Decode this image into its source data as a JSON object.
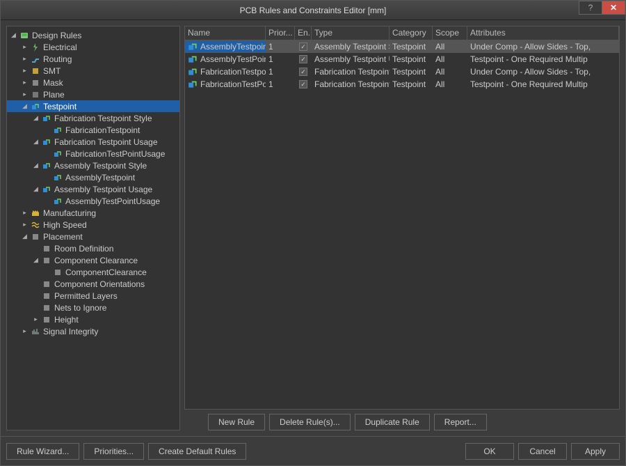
{
  "title": "PCB Rules and Constraints Editor [mm]",
  "tree": [
    {
      "label": "Design Rules",
      "indent": 0,
      "expander": "open",
      "icon": "rules"
    },
    {
      "label": "Electrical",
      "indent": 1,
      "expander": "closed",
      "icon": "electrical"
    },
    {
      "label": "Routing",
      "indent": 1,
      "expander": "closed",
      "icon": "routing"
    },
    {
      "label": "SMT",
      "indent": 1,
      "expander": "closed",
      "icon": "smt"
    },
    {
      "label": "Mask",
      "indent": 1,
      "expander": "closed",
      "icon": "mask"
    },
    {
      "label": "Plane",
      "indent": 1,
      "expander": "closed",
      "icon": "plane"
    },
    {
      "label": "Testpoint",
      "indent": 1,
      "expander": "open",
      "icon": "testpoint",
      "selected": true
    },
    {
      "label": "Fabrication Testpoint Style",
      "indent": 2,
      "expander": "open",
      "icon": "testpoint"
    },
    {
      "label": "FabricationTestpoint",
      "indent": 3,
      "expander": "none",
      "icon": "testpoint"
    },
    {
      "label": "Fabrication Testpoint Usage",
      "indent": 2,
      "expander": "open",
      "icon": "testpoint"
    },
    {
      "label": "FabricationTestPointUsage",
      "indent": 3,
      "expander": "none",
      "icon": "testpoint"
    },
    {
      "label": "Assembly Testpoint Style",
      "indent": 2,
      "expander": "open",
      "icon": "testpoint"
    },
    {
      "label": "AssemblyTestpoint",
      "indent": 3,
      "expander": "none",
      "icon": "testpoint"
    },
    {
      "label": "Assembly Testpoint Usage",
      "indent": 2,
      "expander": "open",
      "icon": "testpoint"
    },
    {
      "label": "AssemblyTestPointUsage",
      "indent": 3,
      "expander": "none",
      "icon": "testpoint"
    },
    {
      "label": "Manufacturing",
      "indent": 1,
      "expander": "closed",
      "icon": "manufacturing"
    },
    {
      "label": "High Speed",
      "indent": 1,
      "expander": "closed",
      "icon": "highspeed"
    },
    {
      "label": "Placement",
      "indent": 1,
      "expander": "open",
      "icon": "placement"
    },
    {
      "label": "Room Definition",
      "indent": 2,
      "expander": "none",
      "icon": "placement"
    },
    {
      "label": "Component Clearance",
      "indent": 2,
      "expander": "open",
      "icon": "placement"
    },
    {
      "label": "ComponentClearance",
      "indent": 3,
      "expander": "none",
      "icon": "placement"
    },
    {
      "label": "Component Orientations",
      "indent": 2,
      "expander": "none",
      "icon": "placement"
    },
    {
      "label": "Permitted Layers",
      "indent": 2,
      "expander": "none",
      "icon": "placement"
    },
    {
      "label": "Nets to Ignore",
      "indent": 2,
      "expander": "none",
      "icon": "placement"
    },
    {
      "label": "Height",
      "indent": 2,
      "expander": "closed",
      "icon": "placement"
    },
    {
      "label": "Signal Integrity",
      "indent": 1,
      "expander": "closed",
      "icon": "signal"
    }
  ],
  "grid": {
    "headers": {
      "name": "Name",
      "priority": "Prior...",
      "enabled": "En...",
      "type": "Type",
      "category": "Category",
      "scope": "Scope",
      "attributes": "Attributes"
    },
    "rows": [
      {
        "name": "AssemblyTestpoint",
        "priority": "1",
        "enabled": true,
        "type": "Assembly Testpoint S",
        "category": "Testpoint",
        "scope": "All",
        "attributes": "Under Comp - Allow    Sides - Top,",
        "selected": true
      },
      {
        "name": "AssemblyTestPointU",
        "priority": "1",
        "enabled": true,
        "type": "Assembly Testpoint U",
        "category": "Testpoint",
        "scope": "All",
        "attributes": "Testpoint - One Required    Multip"
      },
      {
        "name": "FabricationTestpoir",
        "priority": "1",
        "enabled": true,
        "type": "Fabrication Testpoint",
        "category": "Testpoint",
        "scope": "All",
        "attributes": "Under Comp - Allow    Sides - Top,"
      },
      {
        "name": "FabricationTestPoin",
        "priority": "1",
        "enabled": true,
        "type": "Fabrication Testpoint",
        "category": "Testpoint",
        "scope": "All",
        "attributes": "Testpoint - One Required    Multip"
      }
    ]
  },
  "buttons": {
    "new_rule": "New Rule",
    "delete_rule": "Delete Rule(s)...",
    "duplicate_rule": "Duplicate Rule",
    "report": "Report...",
    "rule_wizard": "Rule Wizard...",
    "priorities": "Priorities...",
    "create_default": "Create Default Rules",
    "ok": "OK",
    "cancel": "Cancel",
    "apply": "Apply"
  }
}
